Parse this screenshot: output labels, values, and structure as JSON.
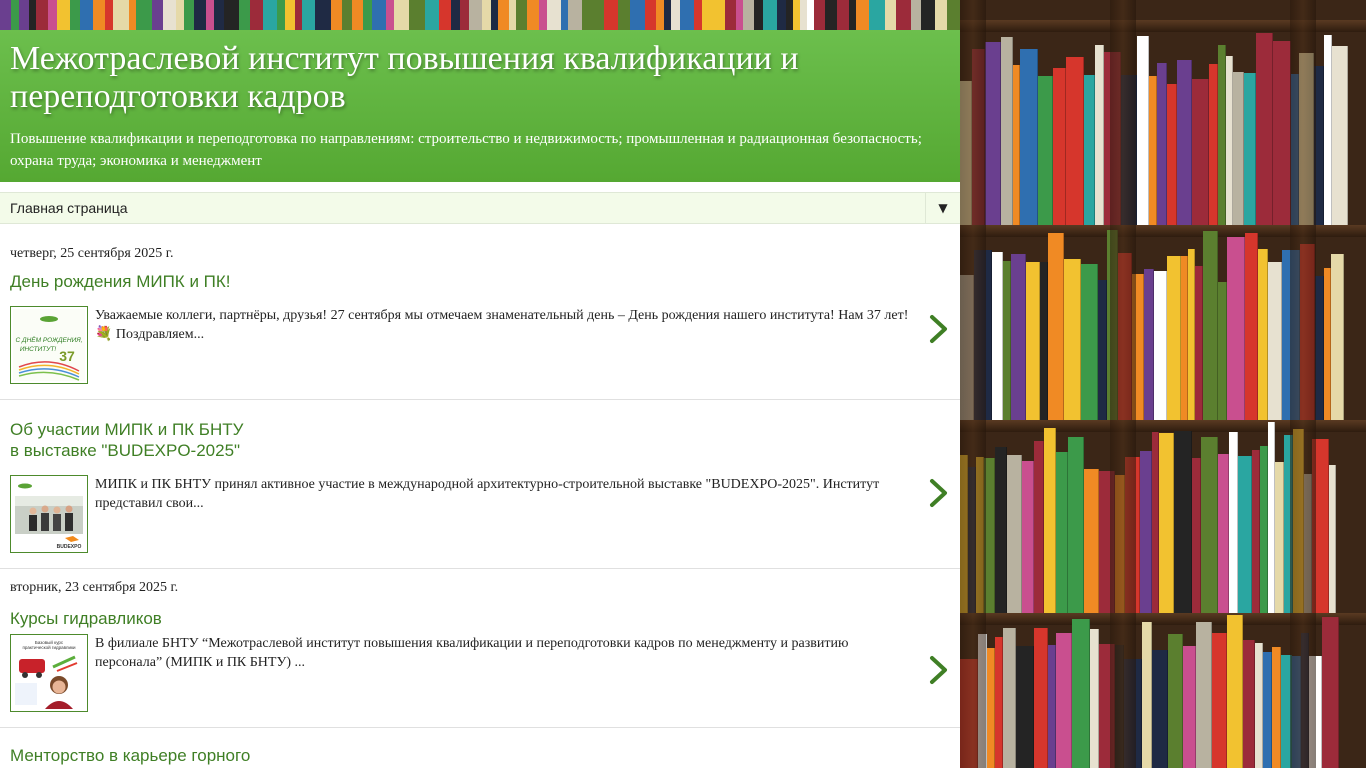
{
  "blog": {
    "title": "Межотраслевой институт повышения квалификации и переподготовки кадров",
    "description": "Повышение квалификации и переподготовка по направлениям: строительство и недвижимость; промышленная и радиационная безопасность; охрана труда; экономика и менеджмент"
  },
  "nav": {
    "current": "Главная страница",
    "dropdown_glyph": "▼"
  },
  "posts": [
    {
      "date": "четверг, 25 сентября 2025 г.",
      "title_lines": [
        "День рождения МИПК и ПК!"
      ],
      "snippet": "Уважаемые коллеги, партнёры, друзья! 27 сентября мы отмечаем знаменательный день – День рождения нашего института! Нам 37 лет! 💐 Поздравляем...",
      "thumb_icon": "birthday-card-thumbnail"
    },
    {
      "date": "",
      "title_lines": [
        "Об участии МИПК и ПК БНТУ",
        "в выставке \"BUDEXPO-2025\""
      ],
      "snippet": "МИПК и ПК БНТУ принял активное участие в международной архитектурно-строительной выставке \"BUDEXPO-2025\". Институт представил свои...",
      "thumb_icon": "exhibition-photo-thumbnail"
    },
    {
      "date": "вторник, 23 сентября 2025 г.",
      "title_lines": [
        "Курсы гидравликов"
      ],
      "snippet": "В филиале БНТУ “Межотраслевой институт повышения квалификации и переподготовки кадров по менеджменту и развитию персонала” (МИПК и ПК БНТУ) ...",
      "thumb_icon": "hydraulics-course-thumbnail"
    },
    {
      "date": "",
      "title_lines": [
        "Менторство в карьере горного"
      ],
      "snippet": "",
      "thumb_icon": ""
    }
  ],
  "colors": {
    "header_green": "#5fb53c",
    "link_green": "#3f7f25",
    "nav_bg": "#f3fbe9"
  }
}
